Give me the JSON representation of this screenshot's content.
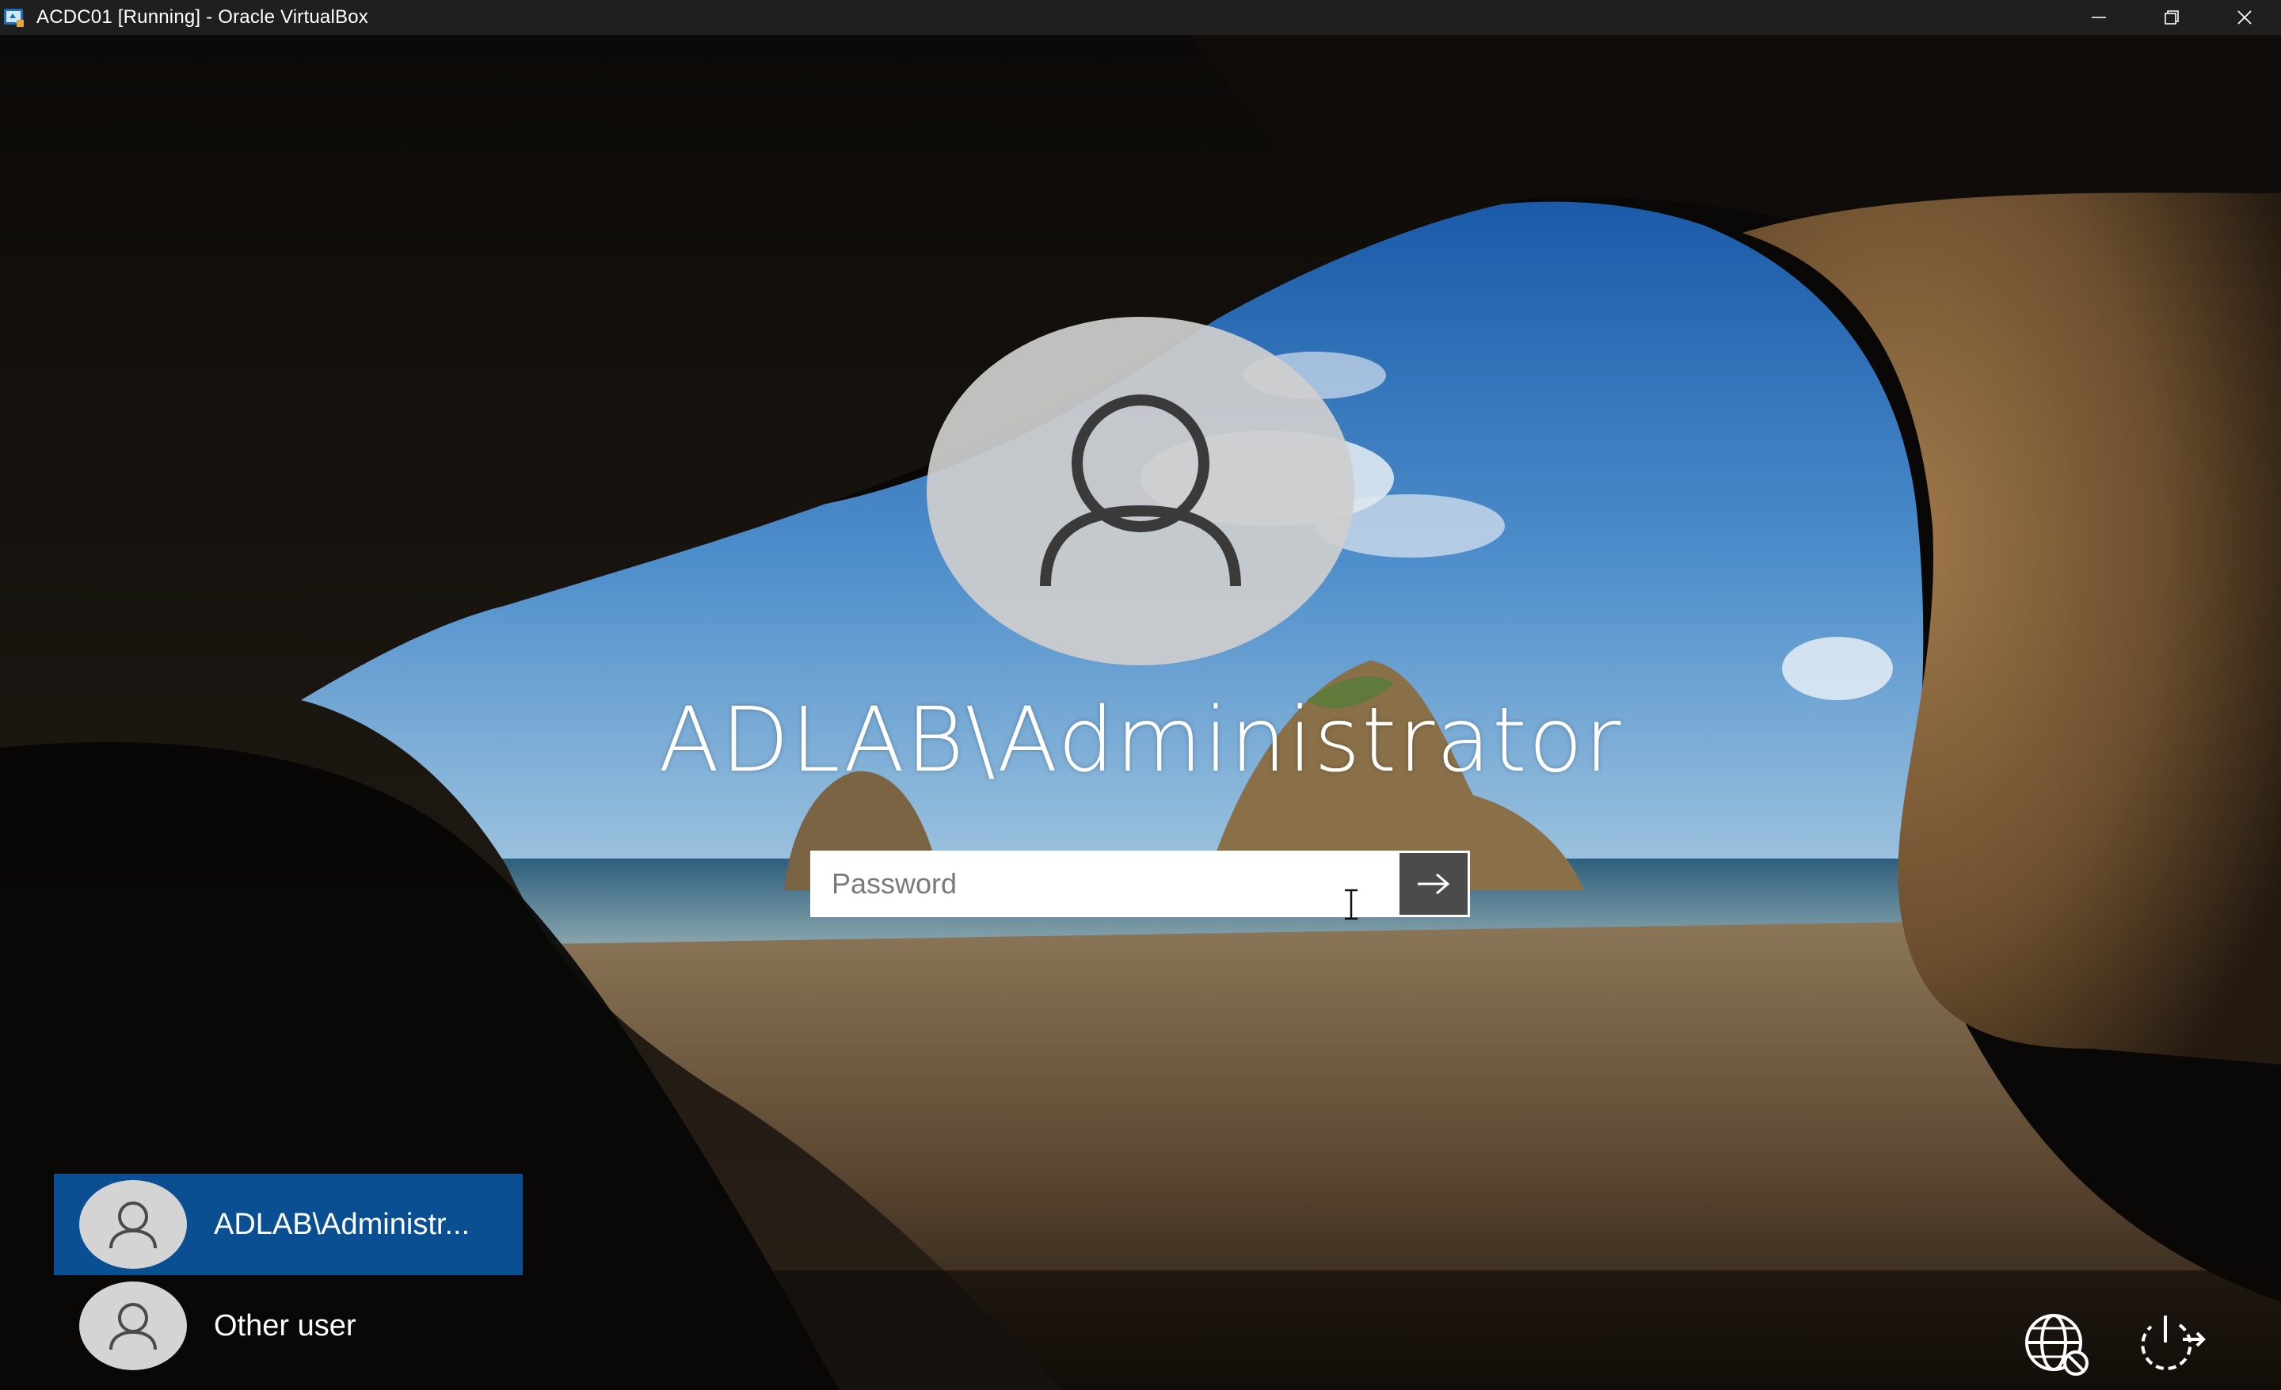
{
  "window": {
    "title": "ACDC01 [Running] - Oracle VirtualBox",
    "app_icon": "virtualbox-icon",
    "controls": [
      "minimize-icon",
      "restore-icon",
      "close-icon"
    ]
  },
  "login": {
    "avatar_icon": "user-icon",
    "user_name": "ADLAB\\Administrator",
    "password_placeholder": "Password",
    "password_value": "",
    "submit_icon": "arrow-right-icon"
  },
  "user_list": [
    {
      "label": "ADLAB\\Administr...",
      "icon": "user-icon",
      "selected": true
    },
    {
      "label": "Other user",
      "icon": "user-icon",
      "selected": false
    }
  ],
  "corner_icons": [
    "network-icon",
    "power-icon"
  ],
  "colors": {
    "titlebar_bg": "#1f1f1f",
    "selected_tile": "#0a4f92",
    "submit_button": "#4b4b4b"
  }
}
